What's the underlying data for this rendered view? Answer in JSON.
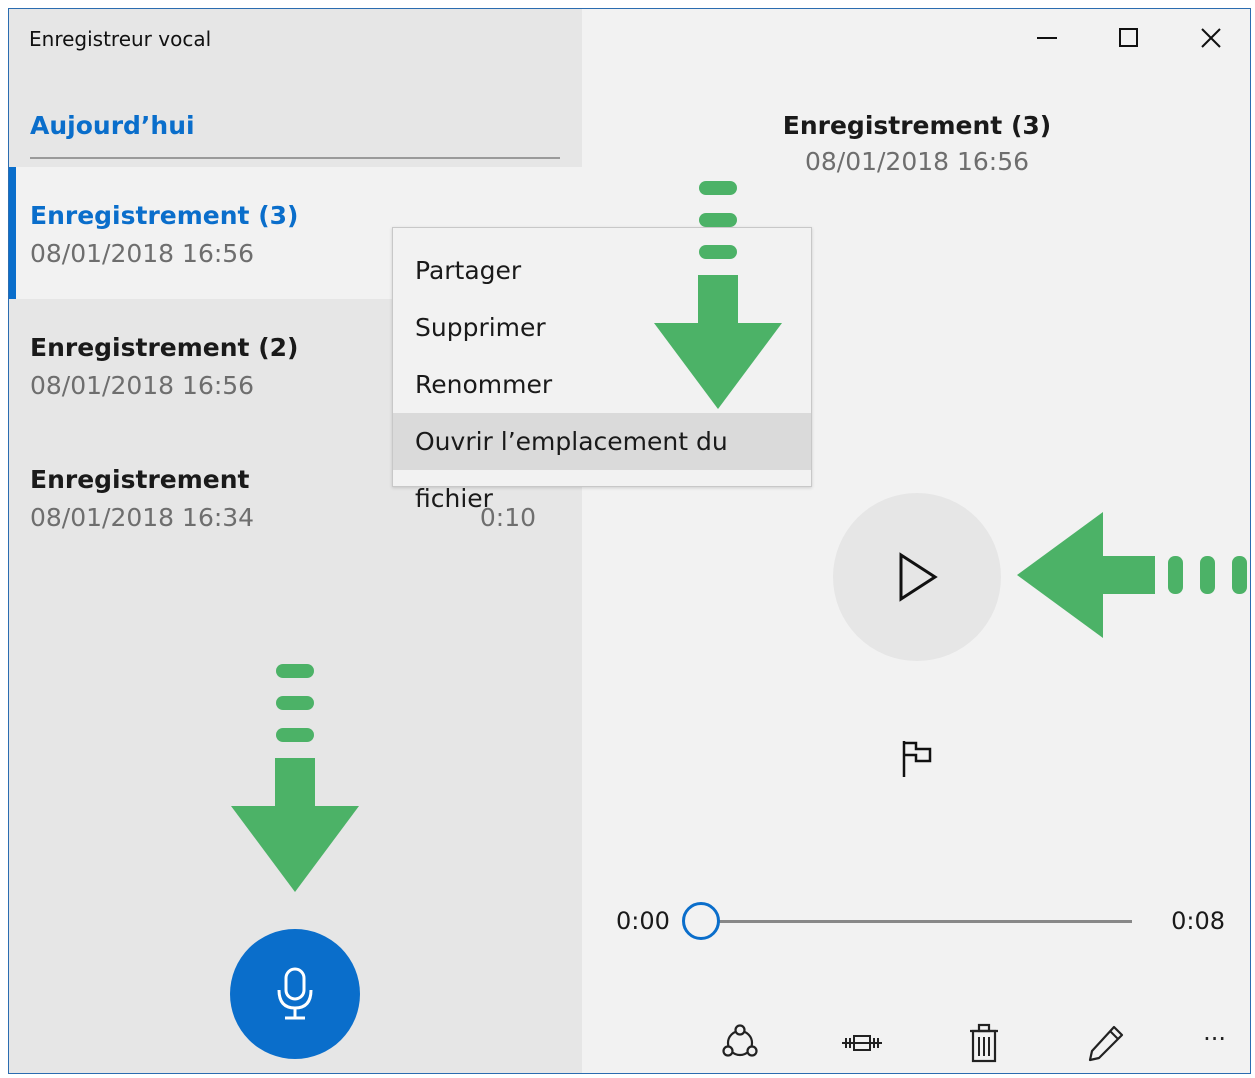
{
  "app": {
    "title": "Enregistreur vocal"
  },
  "titlebar": {
    "minimize_icon": "minimize-icon",
    "maximize_icon": "maximize-icon",
    "close_icon": "close-icon"
  },
  "list": {
    "group_header": "Aujourd’hui",
    "recordings": [
      {
        "name": "Enregistrement (3)",
        "date": "08/01/2018 16:56",
        "duration": "",
        "selected": true
      },
      {
        "name": "Enregistrement (2)",
        "date": "08/01/2018 16:56",
        "duration": ""
      },
      {
        "name": "Enregistrement",
        "date": "08/01/2018 16:34",
        "duration": "0:10"
      }
    ]
  },
  "context_menu": {
    "items": [
      {
        "label": "Partager"
      },
      {
        "label": "Supprimer"
      },
      {
        "label": "Renommer"
      },
      {
        "label": "Ouvrir l’emplacement du fichier",
        "hovered": true
      }
    ]
  },
  "player": {
    "title": "Enregistrement (3)",
    "date": "08/01/2018 16:56",
    "current_time": "0:00",
    "total_time": "0:08",
    "progress": 0
  },
  "toolbar": {
    "icons": [
      "share-icon",
      "trim-icon",
      "delete-icon",
      "rename-icon",
      "more-icon"
    ],
    "more_label": "···"
  },
  "colors": {
    "accent": "#0a6ecb",
    "annotation_arrow": "#4cb267"
  }
}
